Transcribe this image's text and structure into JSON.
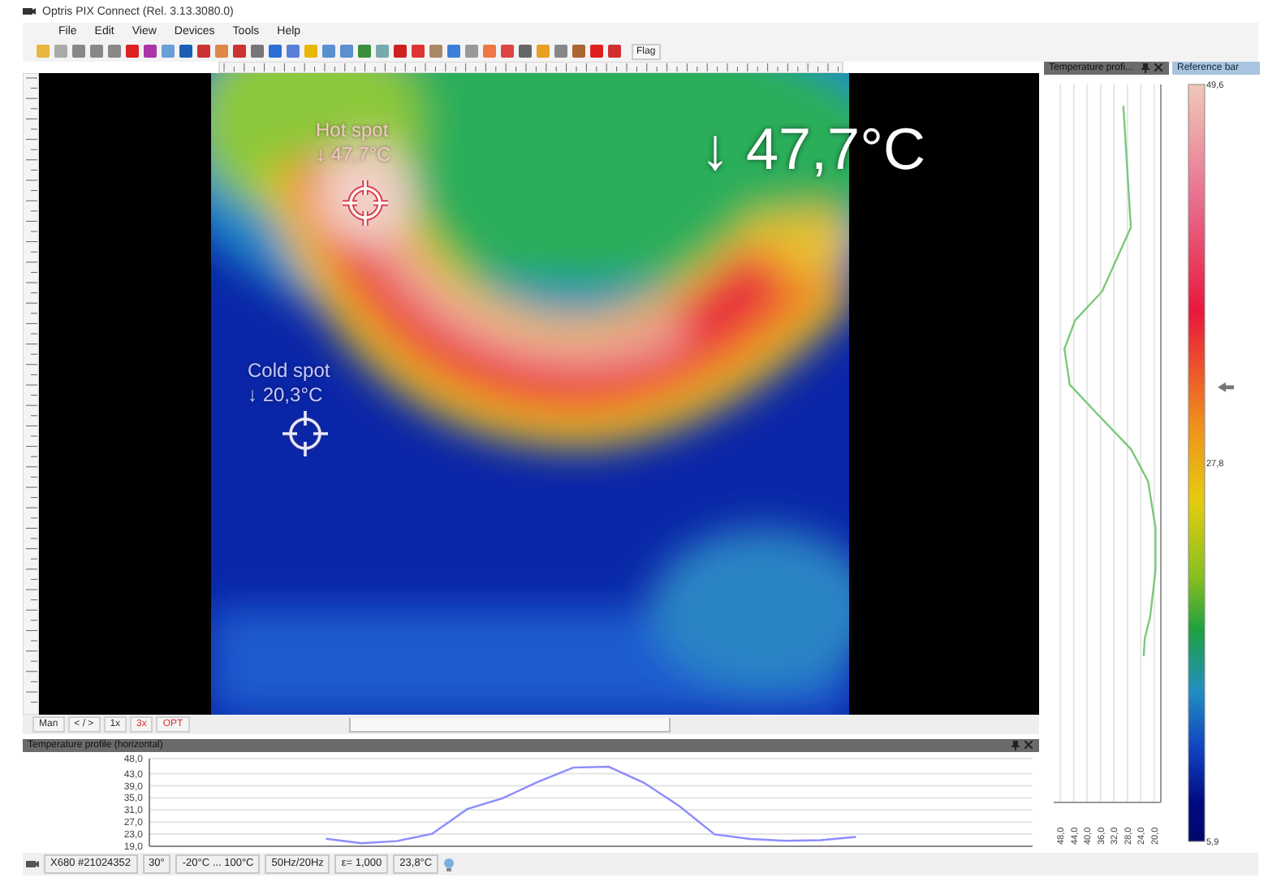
{
  "window": {
    "title": "Optris PIX Connect (Rel. 3.13.3080.0)"
  },
  "menu": [
    "File",
    "Edit",
    "View",
    "Devices",
    "Tools",
    "Help"
  ],
  "toolbar": {
    "flag_button": "Flag"
  },
  "thermal_view": {
    "hot_spot": {
      "label": "Hot spot",
      "reading": "↓ 47,7°C"
    },
    "cold_spot": {
      "label": "Cold spot",
      "reading": "↓ 20,3°C"
    },
    "main_reading": "↓ 47,7°C"
  },
  "view_controls": [
    {
      "label": "Man",
      "highlighted": false
    },
    {
      "label": "< / >",
      "highlighted": false
    },
    {
      "label": "1x",
      "highlighted": false
    },
    {
      "label": "3x",
      "highlighted": true
    },
    {
      "label": "OPT",
      "highlighted": true
    }
  ],
  "horizontal_profile": {
    "title": "Temperature profile (horizontal)",
    "chart_data": {
      "type": "line",
      "categories": [
        null,
        null,
        null,
        null,
        null,
        null,
        null,
        null,
        null,
        null,
        null,
        null,
        null,
        null,
        null,
        null,
        null,
        null,
        null,
        null,
        null,
        null,
        null,
        null,
        null,
        null
      ],
      "series": [
        {
          "color": "#8c8cff",
          "values": [
            null,
            null,
            null,
            null,
            null,
            21.5,
            20.0,
            20.7,
            23.1,
            31.3,
            34.9,
            40.3,
            45.0,
            45.3,
            40.0,
            32.3,
            22.9,
            21.4,
            20.8,
            21.0,
            22.1,
            null,
            null,
            null,
            null,
            null
          ]
        }
      ],
      "ylim": [
        19,
        48
      ],
      "grid": true,
      "yticks": [
        {
          "value": 48,
          "label": "48,0"
        },
        {
          "value": 43,
          "label": "43,0"
        },
        {
          "value": 39,
          "label": "39,0"
        },
        {
          "value": 35,
          "label": "35,0"
        },
        {
          "value": 31,
          "label": "31,0"
        },
        {
          "value": 27,
          "label": "27,0"
        },
        {
          "value": 23,
          "label": "23,0"
        },
        {
          "value": 19,
          "label": "19,0"
        }
      ]
    }
  },
  "vertical_profile": {
    "title": "Temperature profi...",
    "axis_labels": [
      "48,0",
      "44,0",
      "40,0",
      "36,0",
      "32,0",
      "28,0",
      "24,0",
      "20,0"
    ]
  },
  "reference_bar": {
    "title": "Reference bar",
    "max_label": "49,6",
    "mid_label": "27,8",
    "min_label": "5,9",
    "level": 0.6
  },
  "status_bar": [
    "X680 #21024352",
    "30°",
    "-20°C ... 100°C",
    "50Hz/20Hz",
    "ε= 1,000",
    "23,8°C"
  ]
}
